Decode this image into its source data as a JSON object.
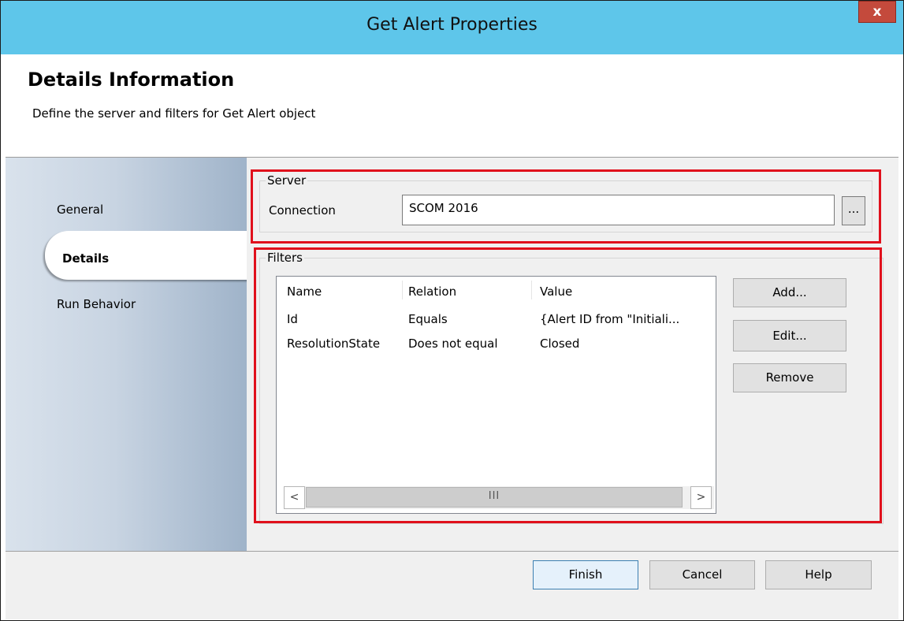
{
  "window": {
    "title": "Get Alert Properties",
    "close_glyph": "x"
  },
  "header": {
    "title": "Details Information",
    "subtitle": "Define the server and filters for Get Alert object"
  },
  "nav": {
    "items": [
      {
        "label": "General"
      },
      {
        "label": "Details"
      },
      {
        "label": "Run Behavior"
      }
    ],
    "active": "Details"
  },
  "server": {
    "group_label": "Server",
    "connection_label": "Connection",
    "connection_value": "SCOM 2016",
    "browse_label": "..."
  },
  "filters": {
    "group_label": "Filters",
    "columns": [
      "Name",
      "Relation",
      "Value"
    ],
    "rows": [
      {
        "name": "Id",
        "relation": "Equals",
        "value": "{Alert ID from \"Initiali..."
      },
      {
        "name": "ResolutionState",
        "relation": "Does not equal",
        "value": "Closed"
      }
    ],
    "scroll_left": "<",
    "scroll_right": ">",
    "scroll_grip": "III",
    "add_label": "Add...",
    "edit_label": "Edit...",
    "remove_label": "Remove"
  },
  "footer": {
    "finish_label": "Finish",
    "cancel_label": "Cancel",
    "help_label": "Help"
  },
  "colors": {
    "titlebar": "#5ec6ea",
    "close": "#c44a3c",
    "highlight": "#e0101c"
  }
}
